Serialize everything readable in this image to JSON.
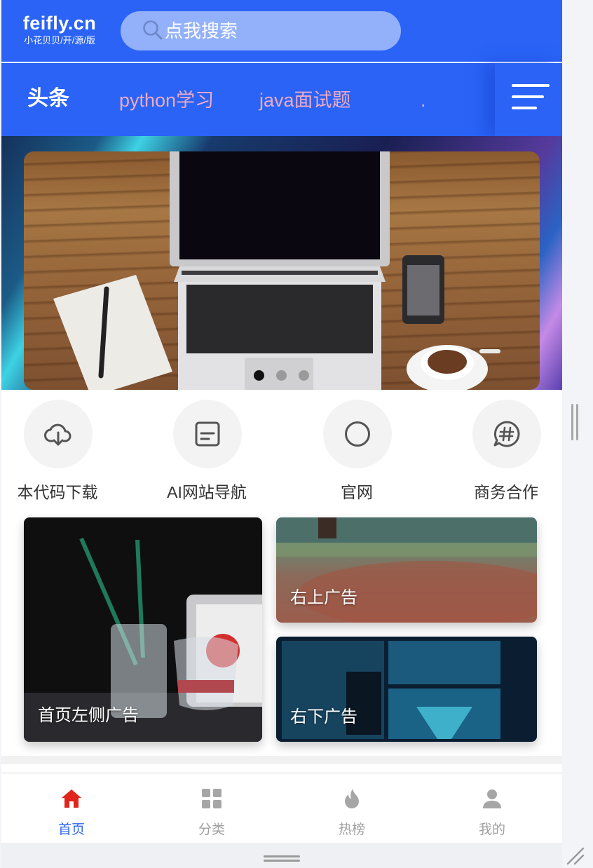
{
  "header": {
    "logo_main": "feifly.cn",
    "logo_sub": "小花贝贝/开/源/版",
    "search_placeholder": "点我搜索",
    "search_icon": "search-icon"
  },
  "tabs": [
    {
      "label": "头条",
      "active": true
    },
    {
      "label": "python学习",
      "active": false
    },
    {
      "label": "java面试题",
      "active": false
    },
    {
      "label": ".",
      "active": false
    }
  ],
  "menu_icon": "menu-icon",
  "banner": {
    "slide_count": 3,
    "active_slide": 1
  },
  "quick_links": [
    {
      "label": "本代码下载",
      "icon": "cloud-download-icon"
    },
    {
      "label": "AI网站导航",
      "icon": "document-icon"
    },
    {
      "label": "官网",
      "icon": "circle-icon"
    },
    {
      "label": "商务合作",
      "icon": "chat-hash-icon"
    }
  ],
  "ads": {
    "left": "首页左侧广告",
    "top_right": "右上广告",
    "bottom_right": "右下广告"
  },
  "bottom_nav": [
    {
      "label": "首页",
      "icon": "home-icon",
      "active": true
    },
    {
      "label": "分类",
      "icon": "grid-icon",
      "active": false
    },
    {
      "label": "热榜",
      "icon": "flame-icon",
      "active": false
    },
    {
      "label": "我的",
      "icon": "user-icon",
      "active": false
    }
  ],
  "colors": {
    "primary": "#2a63f6",
    "tab_inactive": "#ecaac6",
    "nav_active_icon": "#e0261c",
    "nav_inactive": "#a0a0a0"
  }
}
